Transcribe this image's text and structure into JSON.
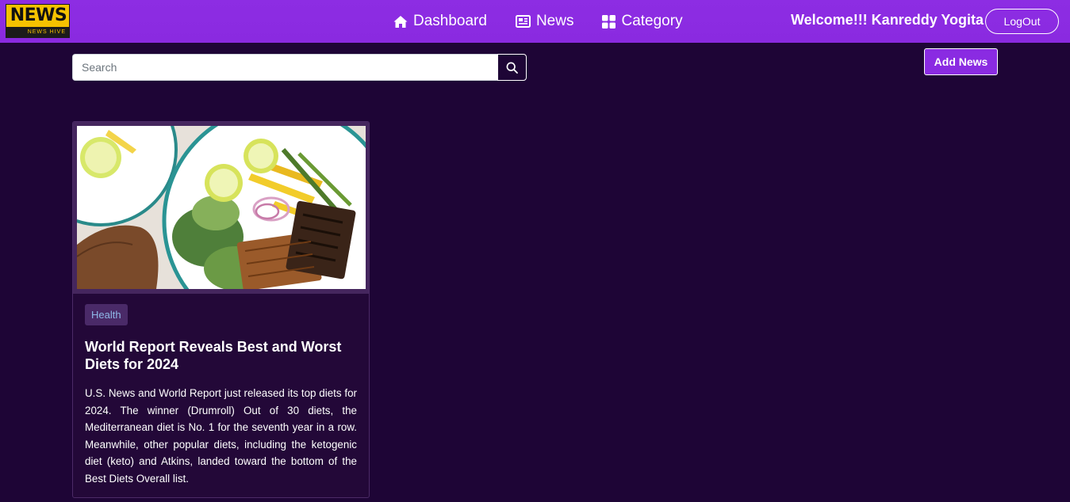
{
  "brand": {
    "logo_word": "NEWS",
    "logo_sub": "NEWS HIVE"
  },
  "nav": {
    "items": [
      {
        "label": "Dashboard",
        "icon": "home-icon"
      },
      {
        "label": "News",
        "icon": "newspaper-icon"
      },
      {
        "label": "Category",
        "icon": "grid-icon"
      }
    ],
    "welcome": "Welcome!!! Kanreddy Yogita",
    "logout_label": "LogOut"
  },
  "search": {
    "placeholder": "Search",
    "value": "",
    "button_icon": "search-icon"
  },
  "actions": {
    "add_news_label": "Add News"
  },
  "news": [
    {
      "image": "salad-plate-photo",
      "category": "Health",
      "title": "World Report Reveals Best and Worst Diets for 2024",
      "summary": "U.S. News and World Report just released its top diets for 2024. The winner (Drumroll) Out of 30 diets, the Mediterranean diet is No. 1 for the seventh year in a row. Meanwhile, other popular diets, including the ketogenic diet (keto) and Atkins, landed toward the bottom of the Best Diets Overall list."
    }
  ],
  "colors": {
    "navbar": "#8a2be2",
    "background": "#1e0536",
    "card": "#230838",
    "badge_bg": "#4a2a68",
    "badge_text": "#8fb8e8",
    "logo": "#f5c200"
  }
}
